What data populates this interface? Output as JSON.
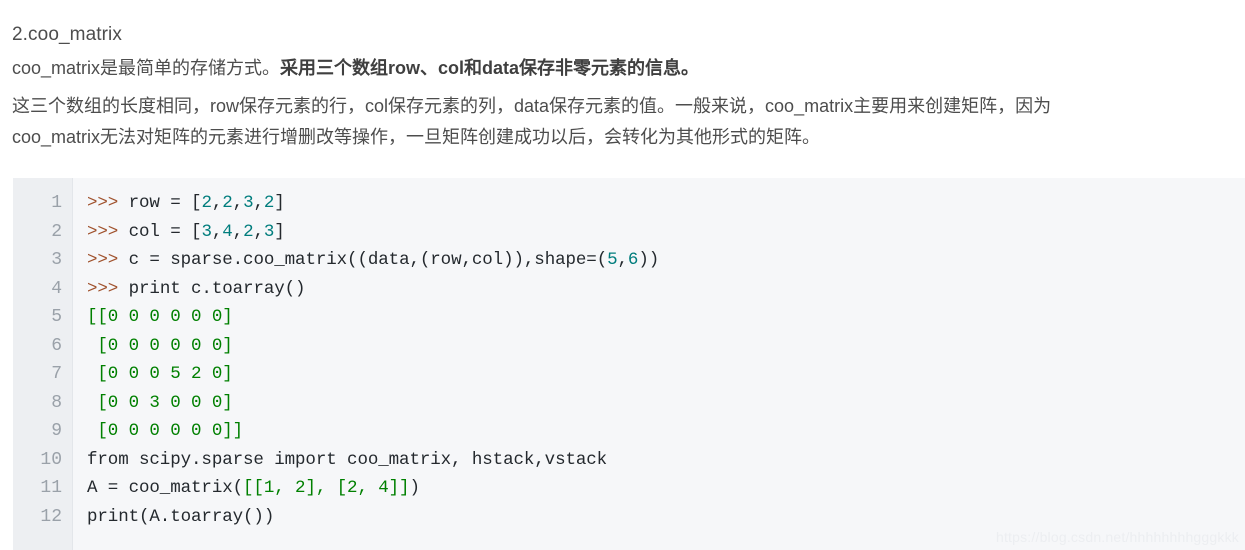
{
  "article": {
    "heading": "2.coo_matrix",
    "paragraph1": {
      "plain_prefix": "coo_matrix是最简单的存储方式。",
      "bold": "采用三个数组row、col和data保存非零元素的信息。"
    },
    "paragraph2": {
      "line1": "这三个数组的长度相同，row保存元素的行，col保存元素的列，data保存元素的值。一般来说，coo_matrix主要用来创建矩阵，因为",
      "line2": "coo_matrix无法对矩阵的元素进行增删改等操作，一旦矩阵创建成功以后，会转化为其他形式的矩阵。"
    }
  },
  "code_block": {
    "line_numbers": [
      "1",
      "2",
      "3",
      "4",
      "5",
      "6",
      "7",
      "8",
      "9",
      "10",
      "11",
      "12"
    ],
    "lines": [
      {
        "number": "1",
        "text": ">>> row = [2,2,3,2]",
        "tokens": [
          {
            "t": ">>>",
            "c": "prompt"
          },
          {
            "t": " row = [",
            "c": "plain"
          },
          {
            "t": "2",
            "c": "num"
          },
          {
            "t": ",",
            "c": "plain"
          },
          {
            "t": "2",
            "c": "num"
          },
          {
            "t": ",",
            "c": "plain"
          },
          {
            "t": "3",
            "c": "num"
          },
          {
            "t": ",",
            "c": "plain"
          },
          {
            "t": "2",
            "c": "num"
          },
          {
            "t": "]",
            "c": "plain"
          }
        ]
      },
      {
        "number": "2",
        "text": ">>> col = [3,4,2,3]",
        "tokens": [
          {
            "t": ">>>",
            "c": "prompt"
          },
          {
            "t": " col = [",
            "c": "plain"
          },
          {
            "t": "3",
            "c": "num"
          },
          {
            "t": ",",
            "c": "plain"
          },
          {
            "t": "4",
            "c": "num"
          },
          {
            "t": ",",
            "c": "plain"
          },
          {
            "t": "2",
            "c": "num"
          },
          {
            "t": ",",
            "c": "plain"
          },
          {
            "t": "3",
            "c": "num"
          },
          {
            "t": "]",
            "c": "plain"
          }
        ]
      },
      {
        "number": "3",
        "text": ">>> c = sparse.coo_matrix((data,(row,col)),shape=(5,6))",
        "tokens": [
          {
            "t": ">>>",
            "c": "prompt"
          },
          {
            "t": " c = sparse.coo_matrix((data,(row,col)),shape=(",
            "c": "plain"
          },
          {
            "t": "5",
            "c": "num"
          },
          {
            "t": ",",
            "c": "plain"
          },
          {
            "t": "6",
            "c": "num"
          },
          {
            "t": "))",
            "c": "plain"
          }
        ]
      },
      {
        "number": "4",
        "text": ">>> print c.toarray()",
        "tokens": [
          {
            "t": ">>>",
            "c": "prompt"
          },
          {
            "t": " print c.toarray()",
            "c": "plain"
          }
        ]
      },
      {
        "number": "5",
        "text": "[[0 0 0 0 0 0]",
        "tokens": [
          {
            "t": "[[0 0 0 0 0 0]",
            "c": "out"
          }
        ]
      },
      {
        "number": "6",
        "text": " [0 0 0 0 0 0]",
        "tokens": [
          {
            "t": " [0 0 0 0 0 0]",
            "c": "out"
          }
        ]
      },
      {
        "number": "7",
        "text": " [0 0 0 5 2 0]",
        "tokens": [
          {
            "t": " [0 0 0 5 2 0]",
            "c": "out"
          }
        ]
      },
      {
        "number": "8",
        "text": " [0 0 3 0 0 0]",
        "tokens": [
          {
            "t": " [0 0 3 0 0 0]",
            "c": "out"
          }
        ]
      },
      {
        "number": "9",
        "text": " [0 0 0 0 0 0]]",
        "tokens": [
          {
            "t": " [0 0 0 0 0 0]]",
            "c": "out"
          }
        ]
      },
      {
        "number": "10",
        "text": "from scipy.sparse import coo_matrix, hstack,vstack",
        "tokens": [
          {
            "t": "from scipy.sparse import coo_matrix, hstack,vstack",
            "c": "plain"
          }
        ]
      },
      {
        "number": "11",
        "text": "A = coo_matrix([[1, 2], [2, 4]])",
        "tokens": [
          {
            "t": "A = coo_matrix(",
            "c": "plain"
          },
          {
            "t": "[[1, 2], [2, 4]]",
            "c": "out"
          },
          {
            "t": ")",
            "c": "plain"
          }
        ]
      },
      {
        "number": "12",
        "text": "print(A.toarray())",
        "tokens": [
          {
            "t": "print(A.toarray())",
            "c": "plain"
          }
        ]
      }
    ]
  },
  "watermark": {
    "text": "https://blog.csdn.net/hhhhhhhhgggkkk"
  },
  "colors": {
    "text": "#4d4d4d",
    "code_bg": "#f6f7f9",
    "gutter_bg": "#edeff2",
    "line_number": "#9aa1a9",
    "prompt": "#a0522d",
    "number_token": "#007d7d",
    "output_token": "#008000",
    "code_text": "#24292e",
    "watermark": "#eceef1"
  }
}
